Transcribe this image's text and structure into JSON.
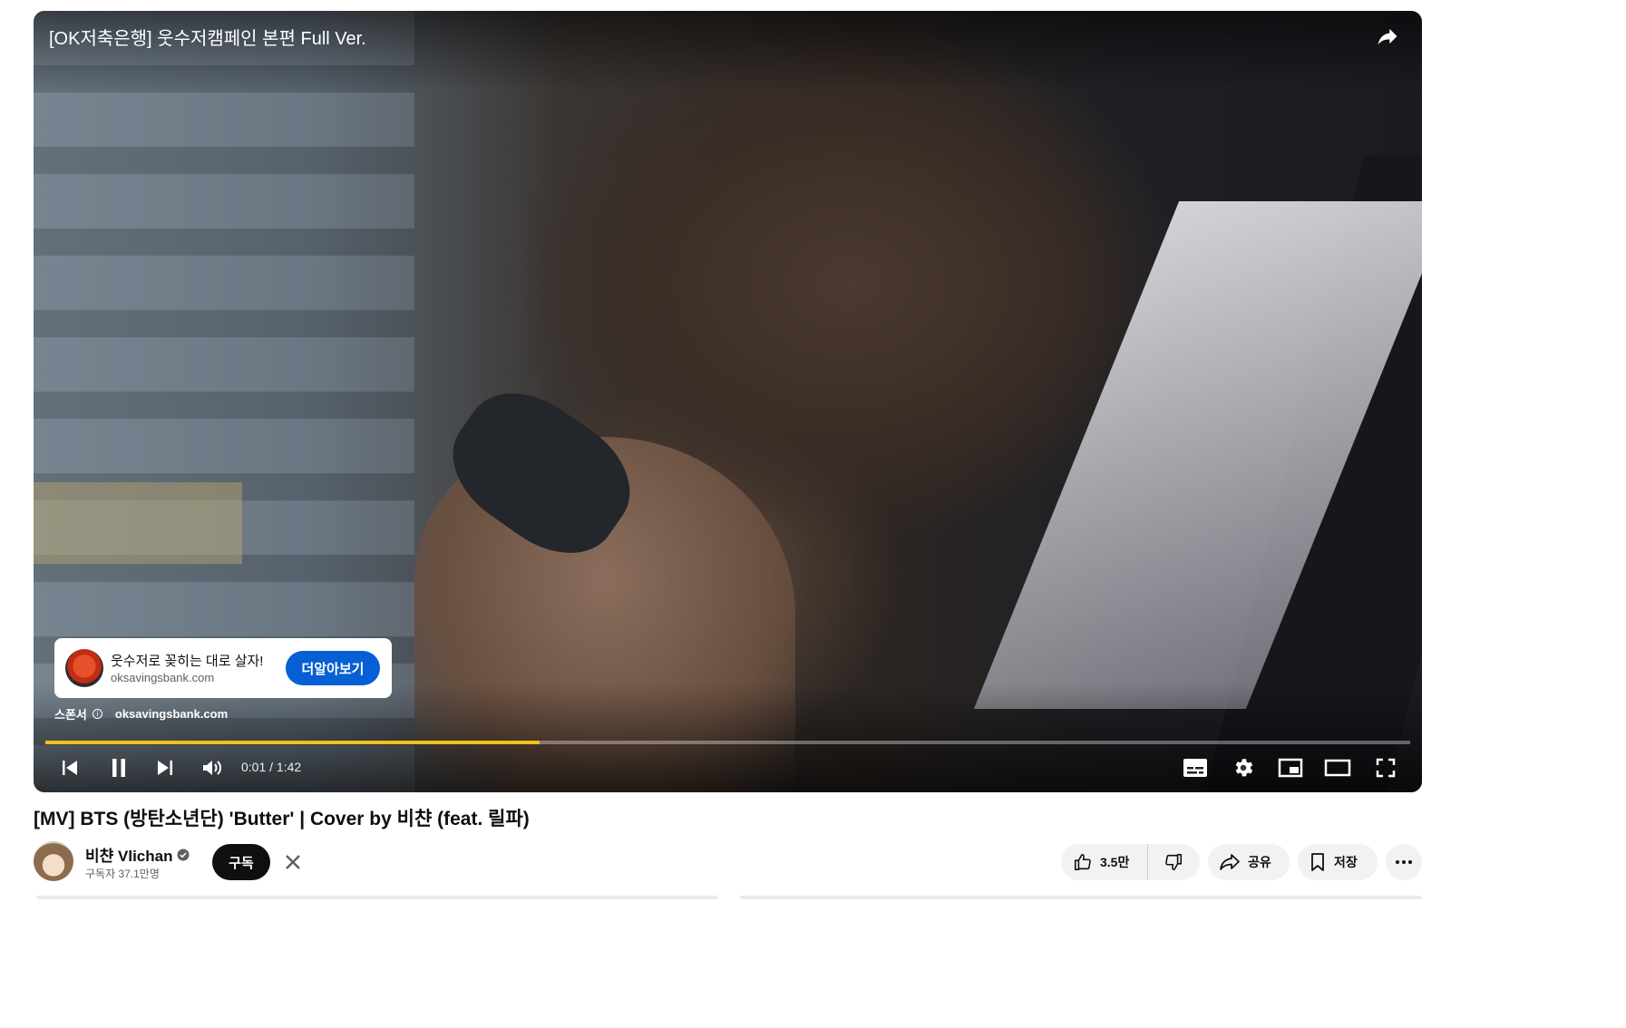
{
  "player": {
    "title": "[OK저축은행] 웃수저캠페인 본편 Full Ver.",
    "progress_fraction": 0.362,
    "time_display": "0:01 / 1:42"
  },
  "ad": {
    "headline": "웃수저로 꽂히는 대로 살자!",
    "domain": "oksavingsbank.com",
    "cta_label": "더알아보기",
    "sponsor_label": "스폰서",
    "sponsor_domain": "oksavingsbank.com",
    "info_glyph": "i"
  },
  "video": {
    "title": "[MV] BTS (방탄소년단) 'Butter' | Cover by 비챤 (feat. 릴파)"
  },
  "channel": {
    "name": "비챤 Vlichan",
    "subscribers": "구독자 37.1만명",
    "subscribe_label": "구독"
  },
  "actions": {
    "like_count": "3.5만",
    "share_label": "공유",
    "save_label": "저장"
  },
  "colors": {
    "progress": "#f2c11c",
    "cta": "#065fd4",
    "subscribe_bg": "#0f0f0f"
  },
  "icons": [
    "share-arrow-icon",
    "prev-icon",
    "pause-icon",
    "next-icon",
    "volume-icon",
    "subtitles-icon",
    "settings-gear-icon",
    "miniplayer-icon",
    "theater-icon",
    "fullscreen-icon",
    "verified-icon",
    "close-icon",
    "thumbs-up-icon",
    "thumbs-down-icon",
    "share-icon",
    "bookmark-icon",
    "more-icon"
  ]
}
